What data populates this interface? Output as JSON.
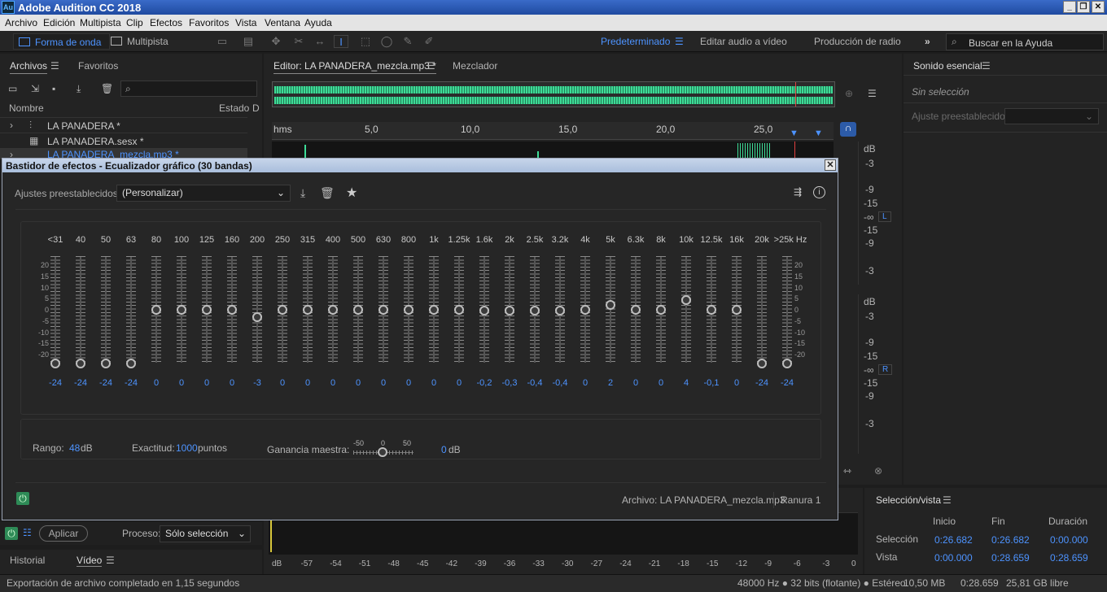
{
  "app": {
    "title": "Adobe Audition CC 2018",
    "logo": "Au"
  },
  "menu": [
    "Archivo",
    "Edición",
    "Multipista",
    "Clip",
    "Efectos",
    "Favoritos",
    "Vista",
    "Ventana",
    "Ayuda"
  ],
  "toolbar": {
    "mode_waveform": "Forma de onda",
    "mode_multitrack": "Multipista",
    "ws_default": "Predeterminado",
    "ws_video": "Editar audio a vídeo",
    "ws_radio": "Producción de radio",
    "more": "»",
    "search_placeholder": "Buscar en la Ayuda"
  },
  "files_panel": {
    "tab_files": "Archivos",
    "tab_favs": "Favoritos",
    "col_name": "Nombre",
    "col_state": "Estado",
    "col_d": "D",
    "items": [
      "LA PANADERA *",
      "LA PANADERA.sesx *",
      "LA PANADERA_mezcla.mp3 *"
    ]
  },
  "editor": {
    "tab_editor": "Editor: LA PANADERA_mezcla.mp3 *",
    "tab_mixer": "Mezclador",
    "ruler_unit": "hms",
    "ruler": [
      "5,0",
      "10,0",
      "15,0",
      "20,0",
      "25,0"
    ],
    "db_label": "dB",
    "db_top": [
      "-3",
      "-9",
      "-15",
      "-∞",
      "-15",
      "-9",
      "-3"
    ],
    "db_bottom": [
      "dB",
      "-3",
      "-9",
      "-15",
      "-∞",
      "-15",
      "-9",
      "-3"
    ],
    "chan_l": "L",
    "chan_r": "R"
  },
  "essential": {
    "title": "Sonido esencial",
    "no_selection": "Sin selección",
    "preset_label": "Ajuste preestablecido:"
  },
  "dialog": {
    "title": "Bastidor de efectos - Ecualizador gráfico (30 bandas)",
    "preset_label": "Ajustes preestablecidos:",
    "preset_value": "(Personalizar)",
    "bands": [
      "<31",
      "40",
      "50",
      "63",
      "80",
      "100",
      "125",
      "160",
      "200",
      "250",
      "315",
      "400",
      "500",
      "630",
      "800",
      "1k",
      "1.25k",
      "1.6k",
      "2k",
      "2.5k",
      "3.2k",
      "4k",
      "5k",
      "6.3k",
      "8k",
      "10k",
      "12.5k",
      "16k",
      "20k",
      ">25k Hz"
    ],
    "gains": [
      "-24",
      "-24",
      "-24",
      "-24",
      "0",
      "0",
      "0",
      "0",
      "-3",
      "0",
      "0",
      "0",
      "0",
      "0",
      "0",
      "0",
      "0",
      "-0,2",
      "-0,3",
      "-0,4",
      "-0,4",
      "0",
      "2",
      "0",
      "0",
      "4",
      "-0,1",
      "0",
      "-24",
      "-24"
    ],
    "scale": [
      "20",
      "15",
      "10",
      "5",
      "0",
      "-5",
      "-10",
      "-15",
      "-20"
    ],
    "range_label": "Rango:",
    "range_value": "48",
    "range_unit": "dB",
    "acc_label": "Exactitud:",
    "acc_value": "1000",
    "acc_unit": "puntos",
    "master_label": "Ganancia maestra:",
    "master_ticks": [
      "-50",
      "0",
      "50"
    ],
    "master_value": "0",
    "master_unit": "dB",
    "file_label": "Archivo: LA PANADERA_mezcla.mp3",
    "slot_label": "Ranura 1"
  },
  "process": {
    "apply": "Aplicar",
    "label": "Proceso:",
    "value": "Sólo selección"
  },
  "history": {
    "tab_history": "Historial",
    "tab_video": "Vídeo"
  },
  "levels": [
    "dB",
    "-57",
    "-54",
    "-51",
    "-48",
    "-45",
    "-42",
    "-39",
    "-36",
    "-33",
    "-30",
    "-27",
    "-24",
    "-21",
    "-18",
    "-15",
    "-12",
    "-9",
    "-6",
    "-3",
    "0"
  ],
  "selection": {
    "title": "Selección/vista",
    "col_start": "Inicio",
    "col_end": "Fin",
    "col_dur": "Duración",
    "row_sel": "Selección",
    "row_view": "Vista",
    "sel": [
      "0:26.682",
      "0:26.682",
      "0:00.000"
    ],
    "view": [
      "0:00.000",
      "0:28.659",
      "0:28.659"
    ]
  },
  "status": {
    "message": "Exportación de archivo completado en 1,15 segundos",
    "format": "48000 Hz ● 32 bits (flotante) ● Estéreo",
    "size": "10,50 MB",
    "dur": "0:28.659",
    "free": "25,81 GB libre"
  },
  "colors": {
    "accent": "#4d93ff",
    "wave": "#3ddc97",
    "playhead": "#e04040"
  }
}
